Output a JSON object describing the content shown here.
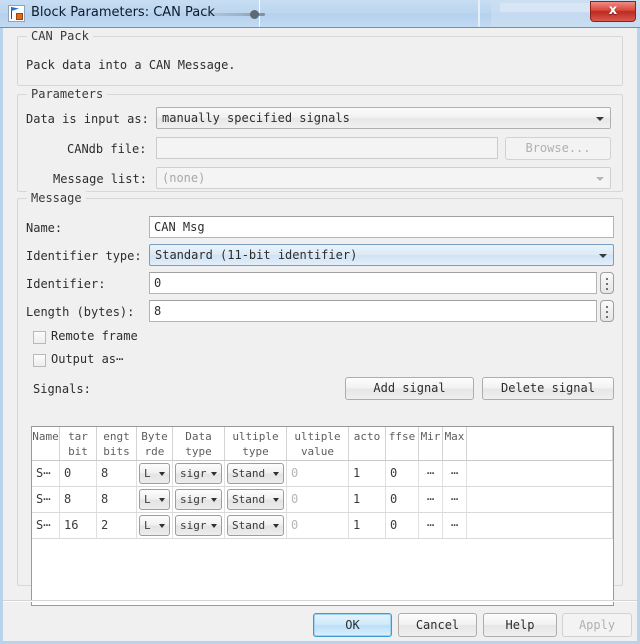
{
  "window": {
    "title": "Block Parameters: CAN Pack",
    "icon": "simulink-block-icon",
    "close_label": "x"
  },
  "description_group": {
    "title": "CAN Pack",
    "text": "Pack data into a CAN Message."
  },
  "parameters_group": {
    "title": "Parameters",
    "data_input_label": "Data is input as:",
    "data_input_value": "manually specified signals",
    "candb_label": "CANdb file:",
    "candb_value": "",
    "browse_label": "Browse...",
    "message_list_label": "Message list:",
    "message_list_value": "(none)"
  },
  "message_group": {
    "title": "Message",
    "name_label": "Name:",
    "name_value": "CAN Msg",
    "identifier_type_label": "Identifier type:",
    "identifier_type_value": "Standard (11-bit identifier)",
    "identifier_label": "Identifier:",
    "identifier_value": "0",
    "length_label": "Length (bytes):",
    "length_value": "8",
    "remote_frame_label": "Remote frame",
    "output_as_label": "Output as⋯",
    "signals_label": "Signals:",
    "add_signal_label": "Add signal",
    "delete_signal_label": "Delete signal"
  },
  "signals_table": {
    "headers": [
      {
        "line1": "",
        "line2": "Name"
      },
      {
        "line1": "tar",
        "line2": "bit"
      },
      {
        "line1": "engt",
        "line2": "bits"
      },
      {
        "line1": "Byte",
        "line2": "rde"
      },
      {
        "line1": "Data",
        "line2": "type"
      },
      {
        "line1": "ultiple",
        "line2": "type"
      },
      {
        "line1": "ultiple",
        "line2": "value"
      },
      {
        "line1": "",
        "line2": "acto"
      },
      {
        "line1": "",
        "line2": "ffse"
      },
      {
        "line1": "",
        "line2": "Mir"
      },
      {
        "line1": "",
        "line2": "Max"
      },
      {
        "line1": "",
        "line2": ""
      }
    ],
    "rows": [
      {
        "name": "S⋯",
        "start_bit": "0",
        "length_bits": "8",
        "byte_order": "L",
        "data_type": "sigr",
        "multiplex_type": "Stand",
        "multiplex_value": "0",
        "factor": "1",
        "offset": "0",
        "min": "⋯",
        "max": "⋯"
      },
      {
        "name": "S⋯",
        "start_bit": "8",
        "length_bits": "8",
        "byte_order": "L",
        "data_type": "sigr",
        "multiplex_type": "Stand",
        "multiplex_value": "0",
        "factor": "1",
        "offset": "0",
        "min": "⋯",
        "max": "⋯"
      },
      {
        "name": "S⋯",
        "start_bit": "16",
        "length_bits": "2",
        "byte_order": "L",
        "data_type": "sigr",
        "multiplex_type": "Stand",
        "multiplex_value": "0",
        "factor": "1",
        "offset": "0",
        "min": "⋯",
        "max": "⋯"
      }
    ]
  },
  "footer": {
    "ok_label": "OK",
    "cancel_label": "Cancel",
    "help_label": "Help",
    "apply_label": "Apply"
  },
  "colors": {
    "titlebar": "#bcd6ef",
    "close_button": "#d8453a",
    "default_button_border": "#3c9ad6",
    "window_border": "#b9d3ec"
  }
}
